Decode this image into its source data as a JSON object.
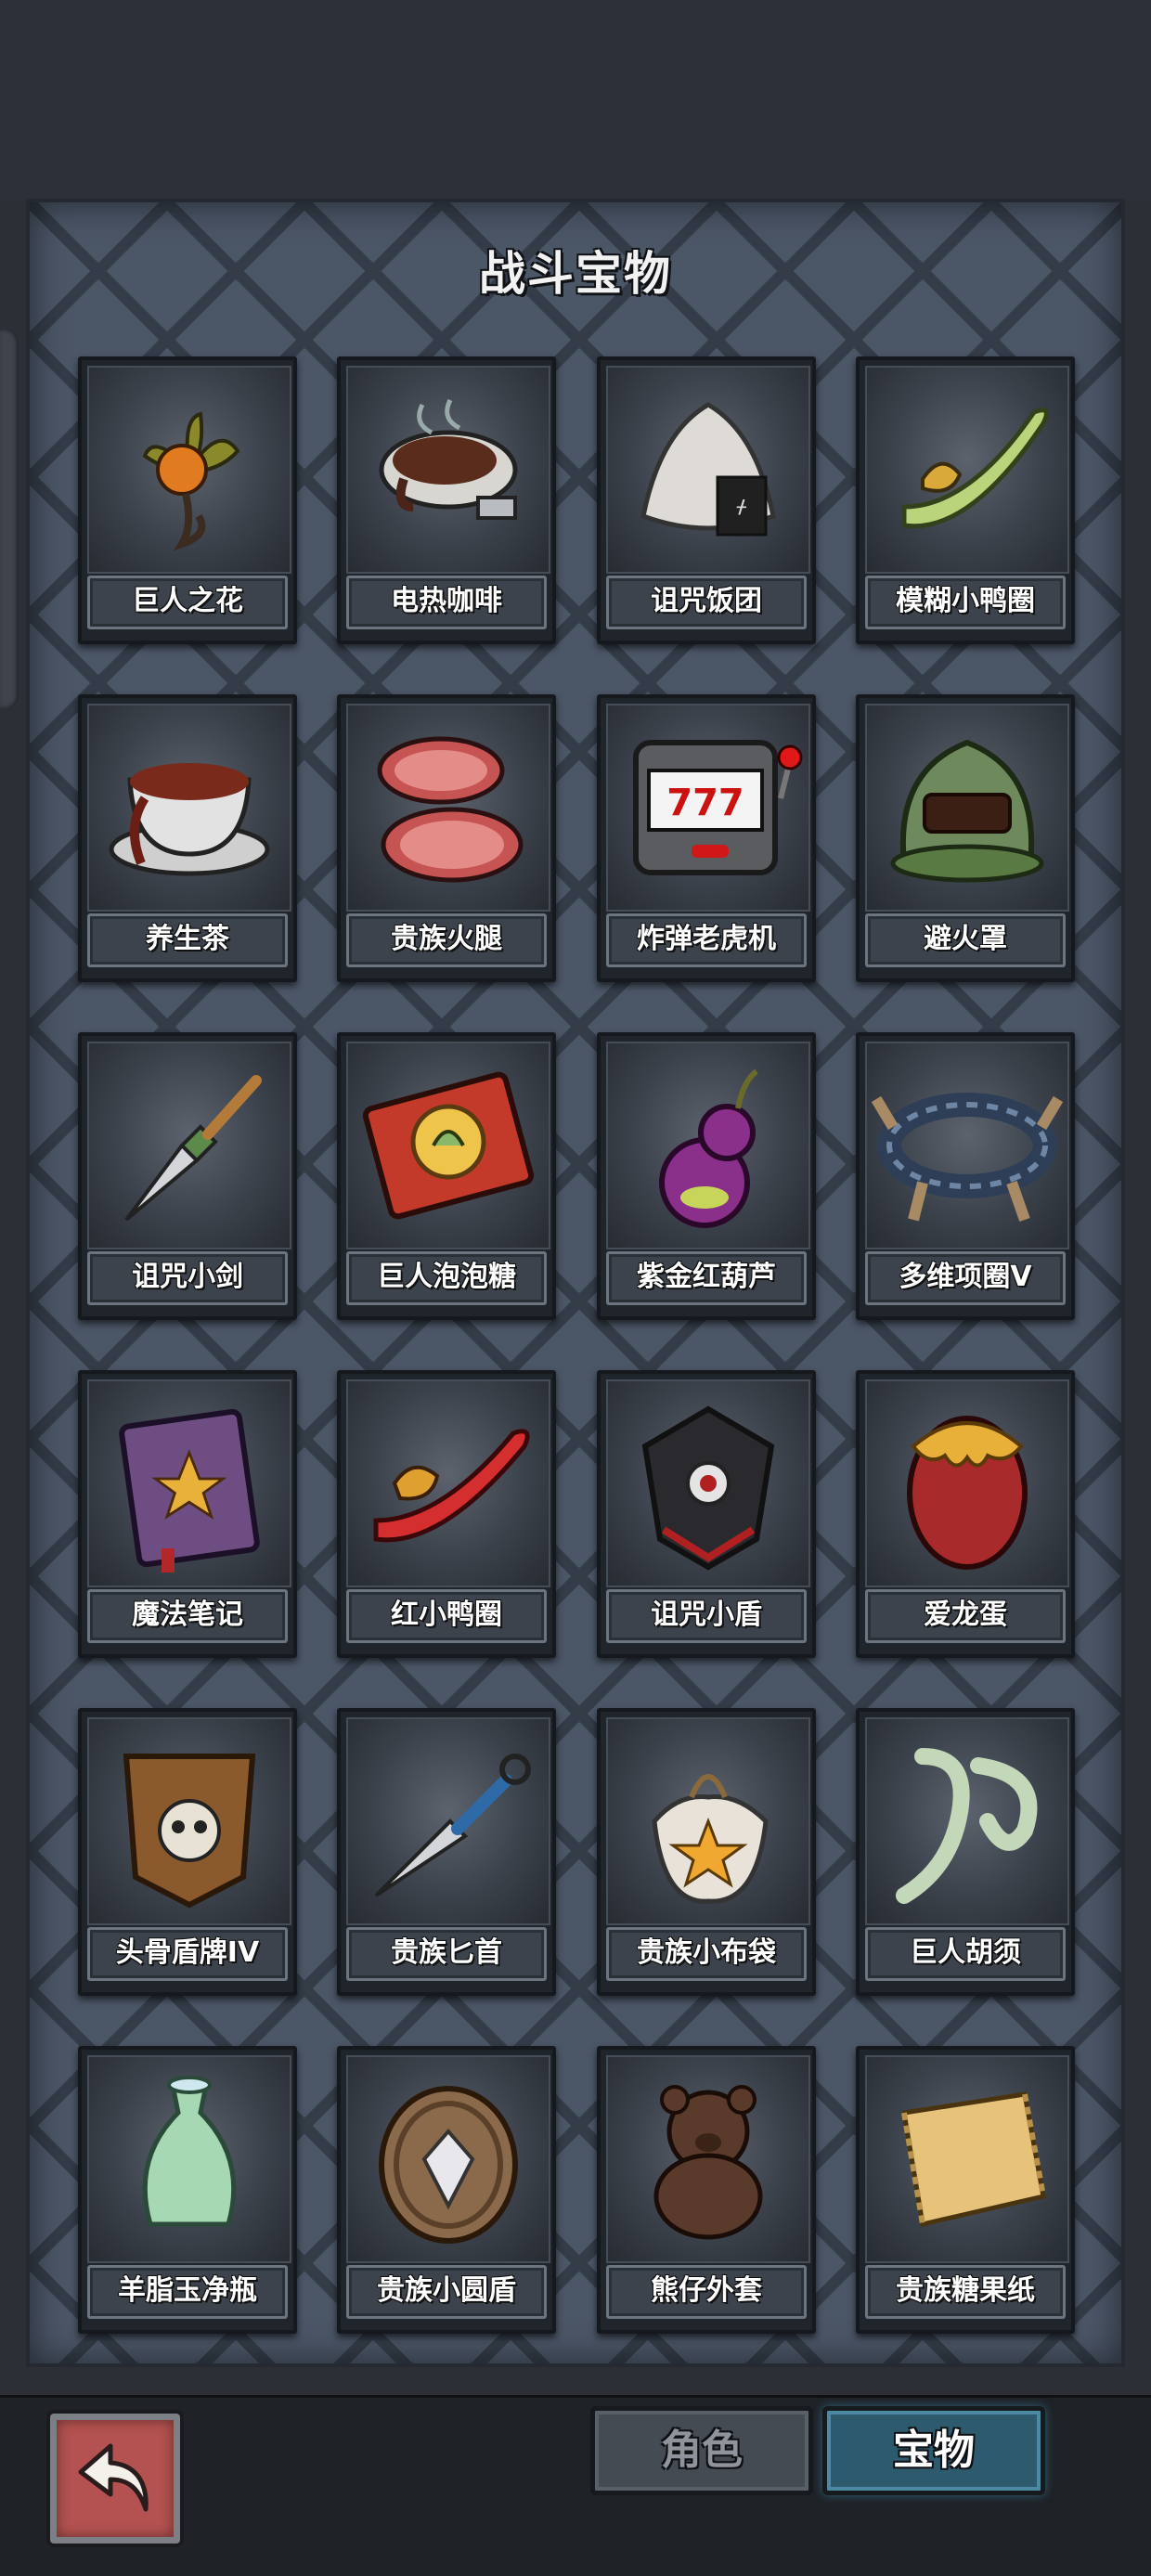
{
  "title": "战斗宝物",
  "items": [
    {
      "name": "巨人之花",
      "icon": "giant-flower-icon"
    },
    {
      "name": "电热咖啡",
      "icon": "electric-coffee-icon"
    },
    {
      "name": "诅咒饭团",
      "icon": "cursed-rice-ball-icon"
    },
    {
      "name": "模糊小鸭圈",
      "icon": "blurry-duck-ring-icon"
    },
    {
      "name": "养生茶",
      "icon": "health-tea-icon"
    },
    {
      "name": "贵族火腿",
      "icon": "noble-ham-icon"
    },
    {
      "name": "炸弹老虎机",
      "icon": "bomb-slot-machine-icon"
    },
    {
      "name": "避火罩",
      "icon": "fire-shield-helmet-icon"
    },
    {
      "name": "诅咒小剑",
      "icon": "cursed-dagger-icon"
    },
    {
      "name": "巨人泡泡糖",
      "icon": "giant-bubble-gum-icon"
    },
    {
      "name": "紫金红葫芦",
      "icon": "purple-gourd-icon"
    },
    {
      "name": "多维项圈V",
      "icon": "multi-collar-icon"
    },
    {
      "name": "魔法笔记",
      "icon": "magic-notebook-icon"
    },
    {
      "name": "红小鸭圈",
      "icon": "red-duck-ring-icon"
    },
    {
      "name": "诅咒小盾",
      "icon": "cursed-shield-icon"
    },
    {
      "name": "爱龙蛋",
      "icon": "dragon-egg-icon"
    },
    {
      "name": "头骨盾牌IV",
      "icon": "skull-shield-icon"
    },
    {
      "name": "贵族匕首",
      "icon": "noble-kunai-icon"
    },
    {
      "name": "贵族小布袋",
      "icon": "noble-pouch-icon"
    },
    {
      "name": "巨人胡须",
      "icon": "giant-beard-icon"
    },
    {
      "name": "羊脂玉净瓶",
      "icon": "jade-vase-icon"
    },
    {
      "name": "贵族小圆盾",
      "icon": "noble-round-shield-icon"
    },
    {
      "name": "熊仔外套",
      "icon": "teddy-bear-coat-icon"
    },
    {
      "name": "贵族糖果纸",
      "icon": "candy-wrapper-icon"
    }
  ],
  "bottom": {
    "back_icon": "back-arrow-icon",
    "tabs": [
      {
        "label": "角色",
        "active": false
      },
      {
        "label": "宝物",
        "active": true
      }
    ]
  },
  "colors": {
    "panel": "#4b5667",
    "back_button": "#b35250",
    "active_tab": "#2e5a6e"
  }
}
